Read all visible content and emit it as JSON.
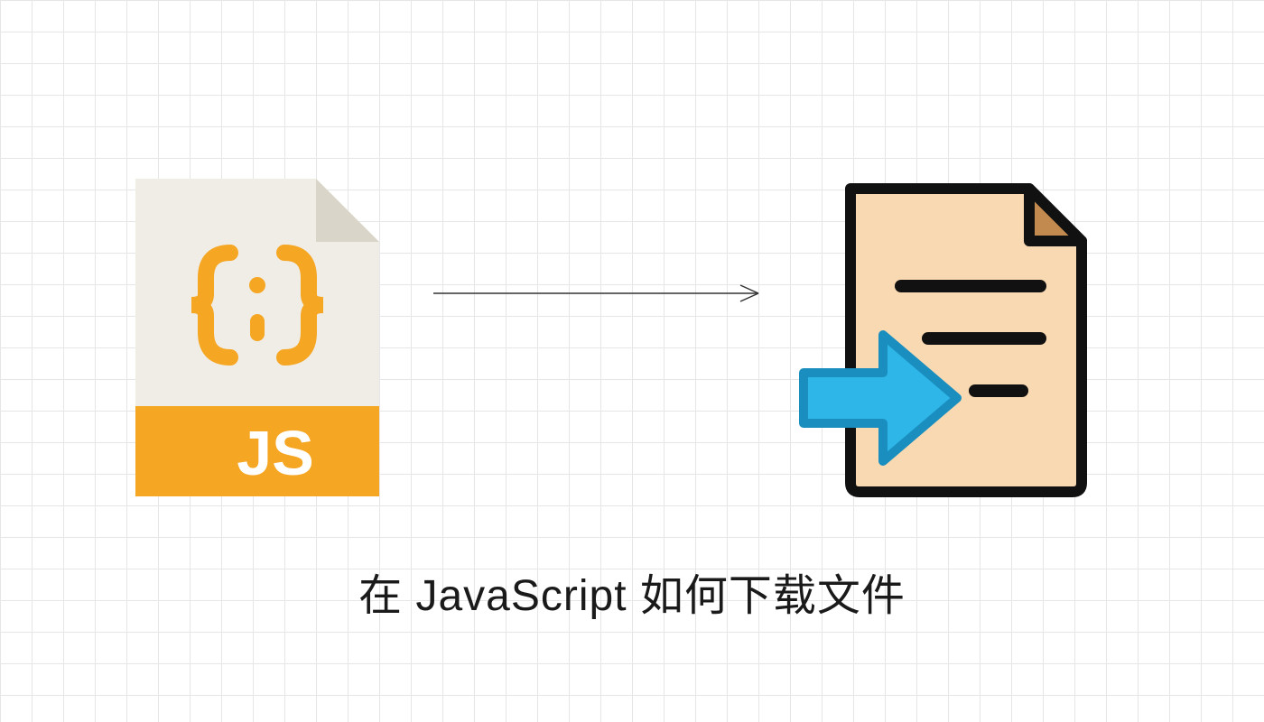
{
  "title": "在 JavaScript 如何下载文件",
  "js_label": "JS",
  "colors": {
    "js_orange": "#f5a623",
    "js_body": "#f0ede6",
    "js_fold": "#d9d5c9",
    "doc_body": "#f9d9b1",
    "doc_fold": "#c28a4e",
    "doc_stroke": "#111111",
    "arrow_blue": "#2eb6e8",
    "arrow_blue_stroke": "#1a8fbf"
  }
}
